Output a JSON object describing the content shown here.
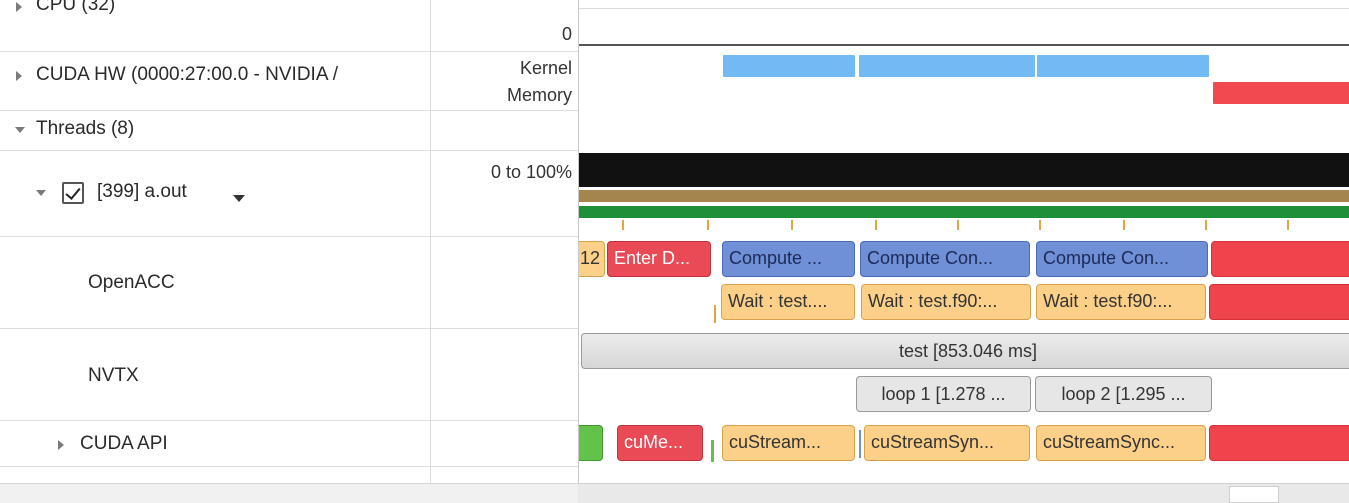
{
  "tree": {
    "cpu_label": "CPU (32)",
    "cuda_hw_label": "CUDA HW (0000:27:00.0 - NVIDIA /",
    "threads_label": "Threads (8)",
    "process_label": "[399] a.out",
    "process_checked": true,
    "openacc_label": "OpenACC",
    "nvtx_label": "NVTX",
    "cuda_api_label": "CUDA API"
  },
  "axis": {
    "cpu_value": "0",
    "kernel_label": "Kernel",
    "memory_label": "Memory",
    "utilization_label": "0 to 100%"
  },
  "openacc": {
    "row1": [
      "12",
      "Enter D...",
      "Compute ...",
      "Compute Con...",
      "Compute Con...",
      ""
    ],
    "row2": [
      "Wait : test....",
      "Wait : test.f90:...",
      "Wait : test.f90:..."
    ]
  },
  "nvtx": {
    "test": "test [853.046 ms]",
    "loop1": "loop 1 [1.278 ...",
    "loop2": "loop 2 [1.295 ..."
  },
  "cuda_api": {
    "bars": [
      "",
      "cuMe...",
      "cuStream...",
      "cuStreamSyn...",
      "cuStreamSync..."
    ]
  },
  "colors": {
    "kernel": "#72baf3",
    "memory": "#f24850",
    "cpu_util": "#111111",
    "thread_state_brown": "#a5854e",
    "thread_state_green": "#1f8f3a",
    "openacc_compute": "#6f8fd6",
    "openacc_enter": "#ea4a55",
    "wait": "#fdd089",
    "nvtx": "#e4e4e4"
  }
}
